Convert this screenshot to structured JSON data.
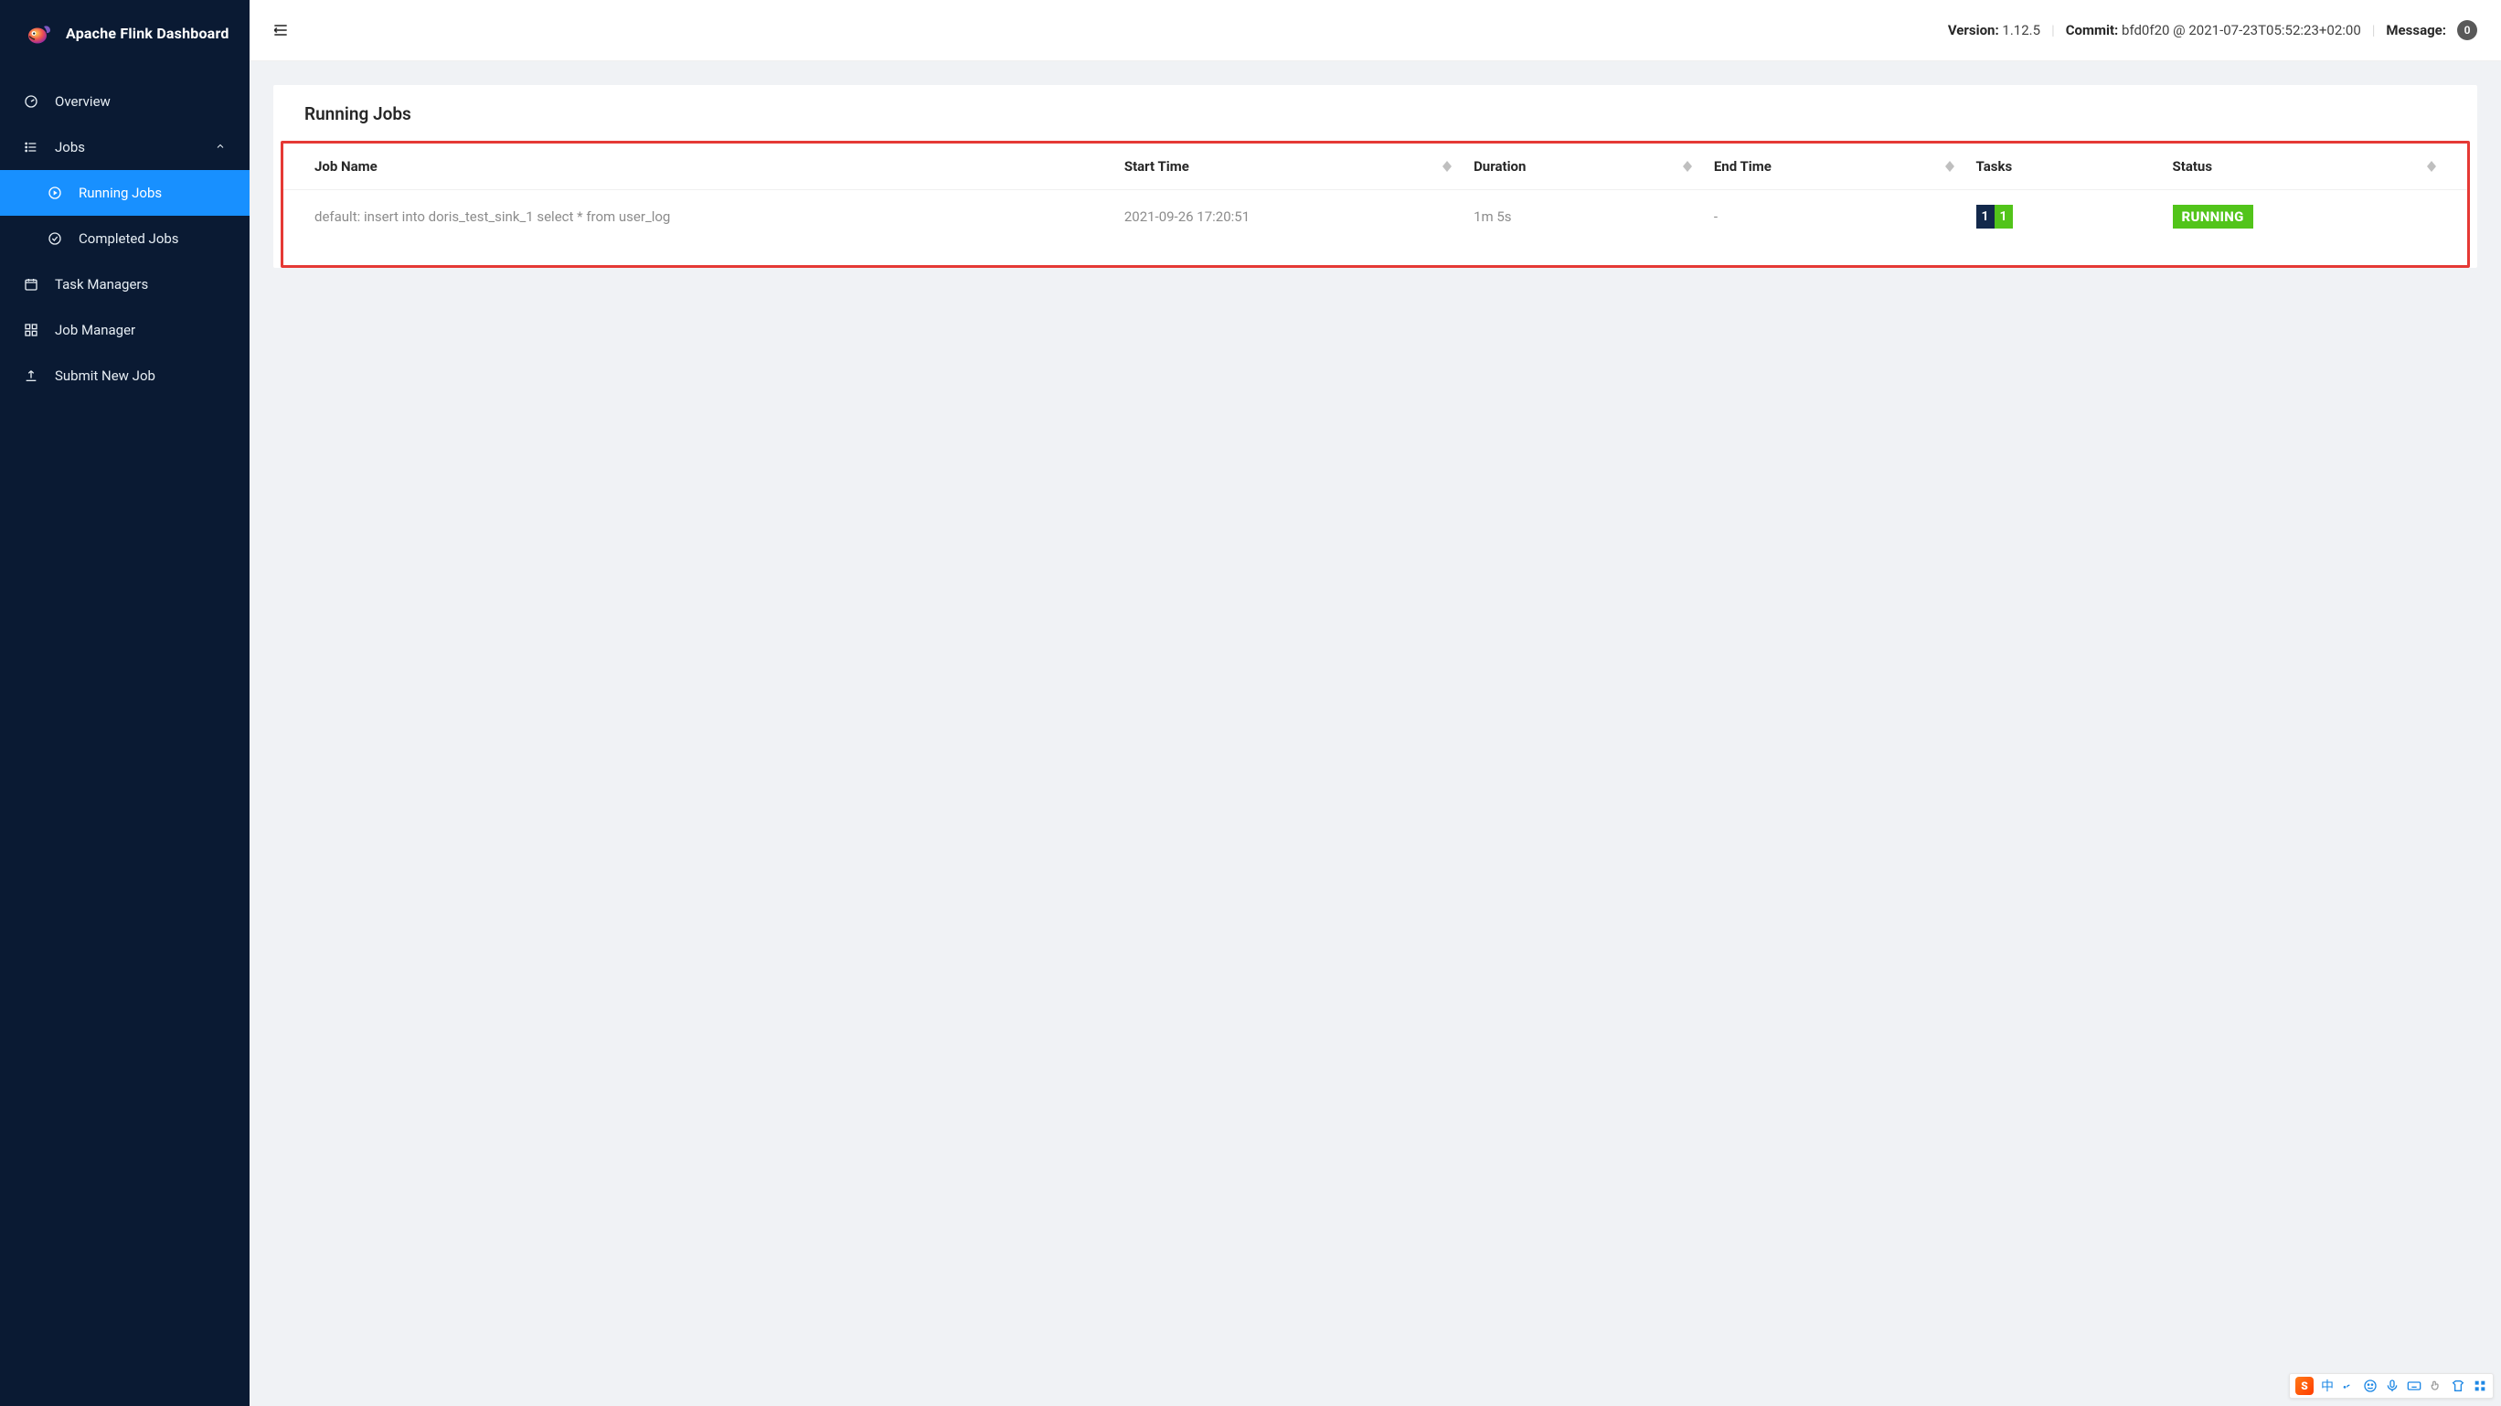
{
  "brand": {
    "title": "Apache Flink Dashboard"
  },
  "sidebar": {
    "overview": "Overview",
    "jobs": "Jobs",
    "running_jobs": "Running Jobs",
    "completed_jobs": "Completed Jobs",
    "task_managers": "Task Managers",
    "job_manager": "Job Manager",
    "submit_new_job": "Submit New Job"
  },
  "topbar": {
    "version_label": "Version:",
    "version_value": "1.12.5",
    "commit_label": "Commit:",
    "commit_value": "bfd0f20 @ 2021-07-23T05:52:23+02:00",
    "message_label": "Message:",
    "message_count": "0"
  },
  "page": {
    "title": "Running Jobs",
    "columns": {
      "job_name": "Job Name",
      "start_time": "Start Time",
      "duration": "Duration",
      "end_time": "End Time",
      "tasks": "Tasks",
      "status": "Status"
    },
    "rows": [
      {
        "job_name": "default: insert into doris_test_sink_1 select * from user_log",
        "start_time": "2021-09-26 17:20:51",
        "duration": "1m 5s",
        "end_time": "-",
        "tasks": {
          "a": "1",
          "b": "1"
        },
        "status": "RUNNING"
      }
    ]
  },
  "ime": {
    "logo": "S",
    "lang": "中"
  }
}
